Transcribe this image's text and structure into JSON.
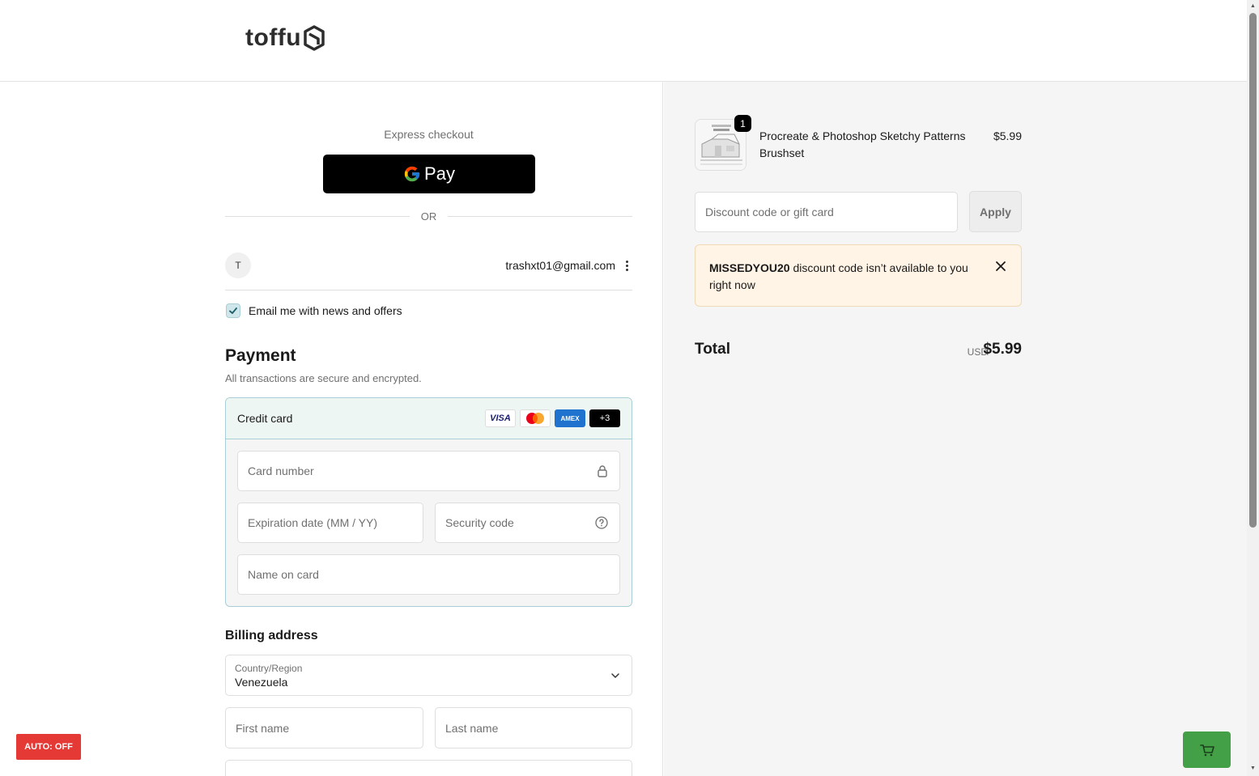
{
  "header": {
    "logo_text": "toffu"
  },
  "express": {
    "label": "Express checkout",
    "gpay_label": "Pay"
  },
  "divider": {
    "or_label": "OR"
  },
  "account": {
    "avatar_letter": "T",
    "email": "trashxt01@gmail.com"
  },
  "newsletter": {
    "label": "Email me with news and offers",
    "checked": true
  },
  "payment": {
    "title": "Payment",
    "subtitle": "All transactions are secure and encrypted.",
    "method_label": "Credit card",
    "card_brands": [
      "VISA",
      "mastercard",
      "AMEX",
      "+3"
    ],
    "card_number_placeholder": "Card number",
    "expiry_placeholder": "Expiration date (MM / YY)",
    "security_placeholder": "Security code",
    "name_placeholder": "Name on card"
  },
  "billing": {
    "title": "Billing address",
    "country_label": "Country/Region",
    "country_value": "Venezuela",
    "first_name_placeholder": "First name",
    "last_name_placeholder": "Last name"
  },
  "auto_toggle": {
    "label": "AUTO: OFF"
  },
  "order": {
    "quantity": "1",
    "product_name": "Procreate & Photoshop Sketchy Patterns Brushset",
    "product_price": "$5.99",
    "discount_placeholder": "Discount code or gift card",
    "apply_label": "Apply",
    "notice_code": "MISSEDYOU20",
    "notice_message": " discount code isn’t available to you right now",
    "total_label": "Total",
    "total_currency": "USD",
    "total_amount": "$5.99"
  },
  "colors": {
    "accent_border": "#a9cfd6",
    "notice_bg": "#fff4e5",
    "auto_off_bg": "#e53935",
    "cart_button_bg": "#43a047"
  }
}
